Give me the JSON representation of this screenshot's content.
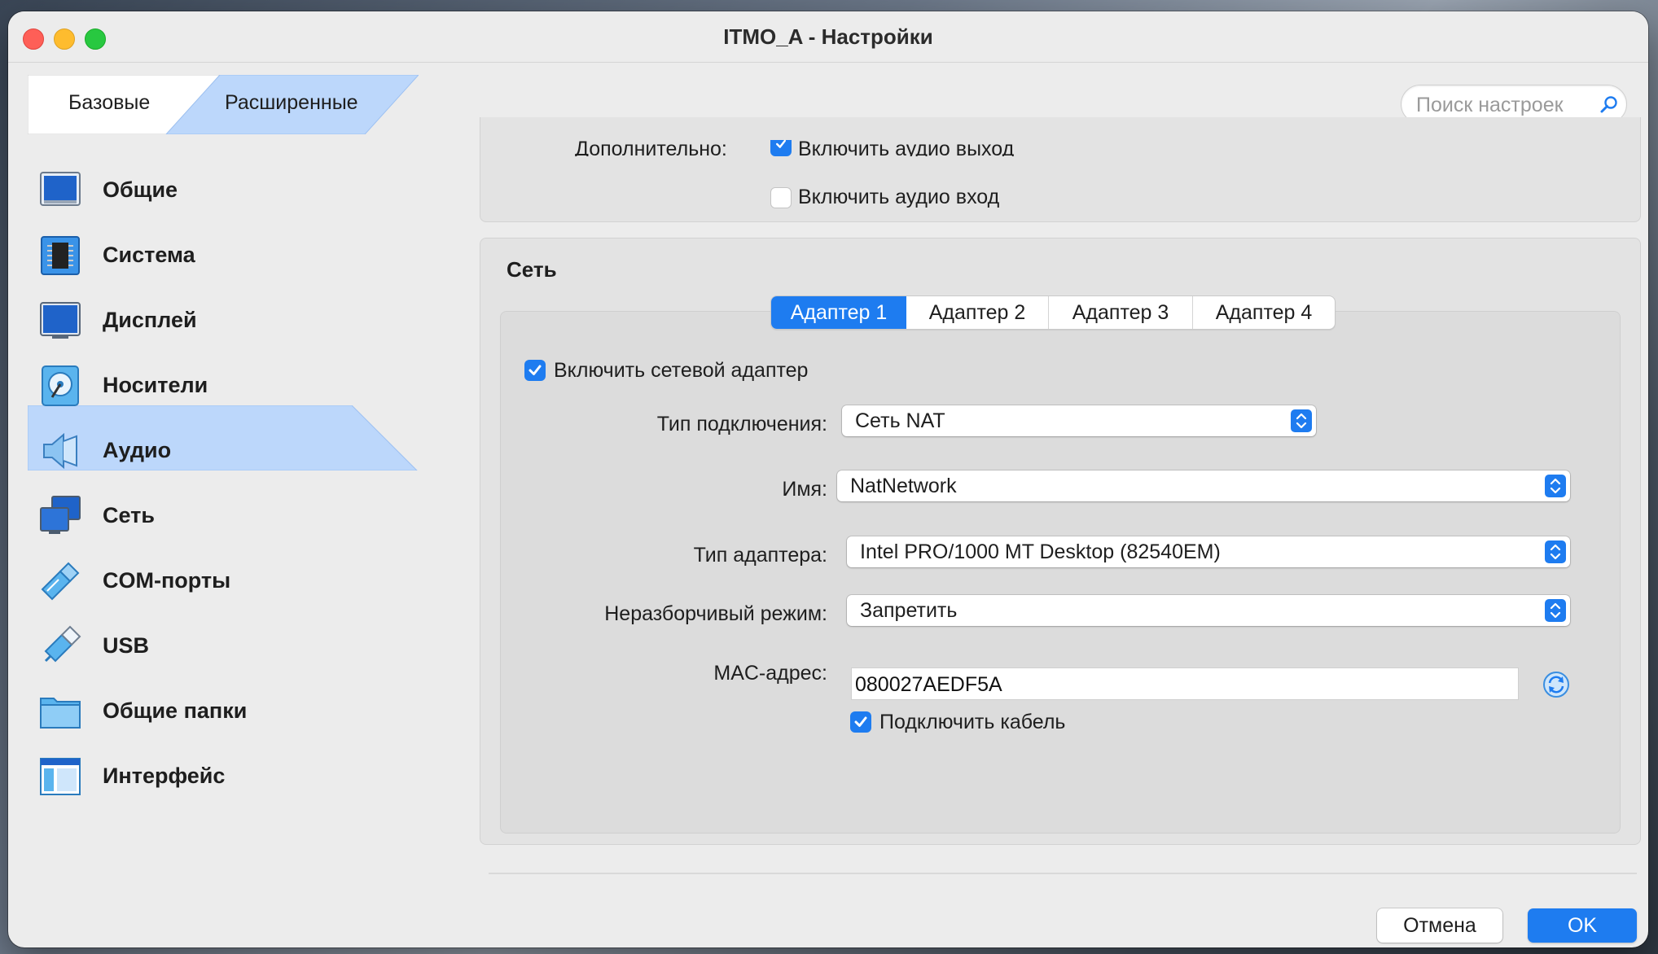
{
  "window": {
    "title": "ITMO_A - Настройки"
  },
  "mode_tabs": {
    "basic": "Базовые",
    "advanced": "Расширенные",
    "selected": "advanced"
  },
  "search": {
    "placeholder": "Поиск настроек"
  },
  "sidebar": {
    "selected": "audio",
    "items": [
      {
        "id": "general",
        "label": "Общие",
        "icon": "general-icon"
      },
      {
        "id": "system",
        "label": "Система",
        "icon": "chip-icon"
      },
      {
        "id": "display",
        "label": "Дисплей",
        "icon": "monitor-icon"
      },
      {
        "id": "storage",
        "label": "Носители",
        "icon": "disk-icon"
      },
      {
        "id": "audio",
        "label": "Аудио",
        "icon": "speaker-icon"
      },
      {
        "id": "network",
        "label": "Сеть",
        "icon": "network-icon"
      },
      {
        "id": "serial",
        "label": "COM-порты",
        "icon": "cable-icon"
      },
      {
        "id": "usb",
        "label": "USB",
        "icon": "usb-icon"
      },
      {
        "id": "shared",
        "label": "Общие папки",
        "icon": "folder-icon"
      },
      {
        "id": "ui",
        "label": "Интерфейс",
        "icon": "window-icon"
      }
    ]
  },
  "audio": {
    "extra_label": "Дополнительно:",
    "audio_out": {
      "label": "Включить аудио выход",
      "checked": true
    },
    "audio_in": {
      "label": "Включить аудио вход",
      "checked": false
    }
  },
  "network": {
    "title": "Сеть",
    "tabs": [
      "Адаптер 1",
      "Адаптер 2",
      "Адаптер 3",
      "Адаптер 4"
    ],
    "active_tab": 0,
    "enable_adapter": {
      "label": "Включить сетевой адаптер",
      "checked": true
    },
    "attachment_label": "Тип подключения:",
    "attachment_value": "Сеть NAT",
    "name_label": "Имя:",
    "name_value": "NatNetwork",
    "adapter_type_label": "Тип адаптера:",
    "adapter_type_value": "Intel PRO/1000 MT Desktop (82540EM)",
    "promisc_label": "Неразборчивый режим:",
    "promisc_value": "Запретить",
    "mac_label": "MAC-адрес:",
    "mac_value": "080027AEDF5A",
    "cable": {
      "label": "Подключить кабель",
      "checked": true
    }
  },
  "buttons": {
    "cancel": "Отмена",
    "ok": "OK"
  },
  "colors": {
    "accent": "#1e7cf0",
    "selection": "#bcd7fb",
    "window_bg": "#ececec"
  }
}
